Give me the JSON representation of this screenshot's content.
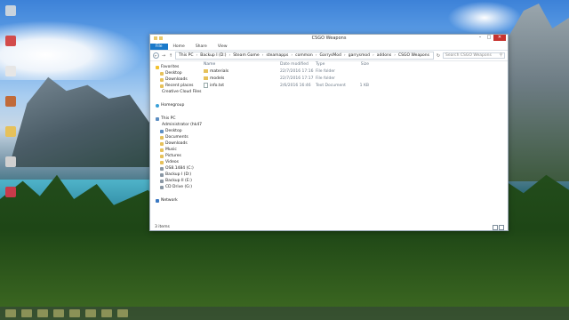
{
  "window": {
    "title": "CSGO Weapons",
    "controls": {
      "minimize": "–",
      "maximize": "□",
      "close": "✕"
    }
  },
  "ribbon": {
    "tabs": [
      "File",
      "Home",
      "Share",
      "View"
    ]
  },
  "navigation": {
    "back": "←",
    "forward": "→",
    "up": "↑",
    "breadcrumb": [
      "This PC",
      "Backup I (D:)",
      "Steam Game",
      "steamapps",
      "common",
      "GarrysMod",
      "garrysmod",
      "addons",
      "CSGO Weapons"
    ],
    "separator": "›",
    "refresh": "↻",
    "search_placeholder": "Search CSGO Weapons",
    "search_icon": "search-icon"
  },
  "nav_pane": {
    "favorites": {
      "label": "Favorites",
      "items": [
        "Desktop",
        "Downloads",
        "Recent places",
        "Creative Cloud Files"
      ]
    },
    "homegroup": "Homegroup",
    "this_pc": {
      "label": "This PC",
      "items": [
        "Administrator (hk47",
        "Desktop",
        "Documents",
        "Downloads",
        "Music",
        "Pictures",
        "Videos",
        "OS8.1484 (C:)",
        "Backup I (D:)",
        "Backup II (E:)",
        "CD Drive (G:)"
      ]
    },
    "network": "Network"
  },
  "content": {
    "columns": {
      "name": "Name",
      "date": "Date modified",
      "type": "Type",
      "size": "Size"
    },
    "files": [
      {
        "name": "materials",
        "date": "22/7/2016 17:16",
        "type": "File folder",
        "size": "",
        "icon": "folder-icon"
      },
      {
        "name": "models",
        "date": "22/7/2016 17:17",
        "type": "File folder",
        "size": "",
        "icon": "folder-icon"
      },
      {
        "name": "info.txt",
        "date": "2/6/2016 16:46",
        "type": "Text Document",
        "size": "1 KB",
        "icon": "text-file-icon"
      }
    ]
  },
  "status": {
    "text": "3 items"
  },
  "colors": {
    "file_tab": "#1979ca",
    "close_button": "#c7332f",
    "folder": "#e6c15b"
  }
}
